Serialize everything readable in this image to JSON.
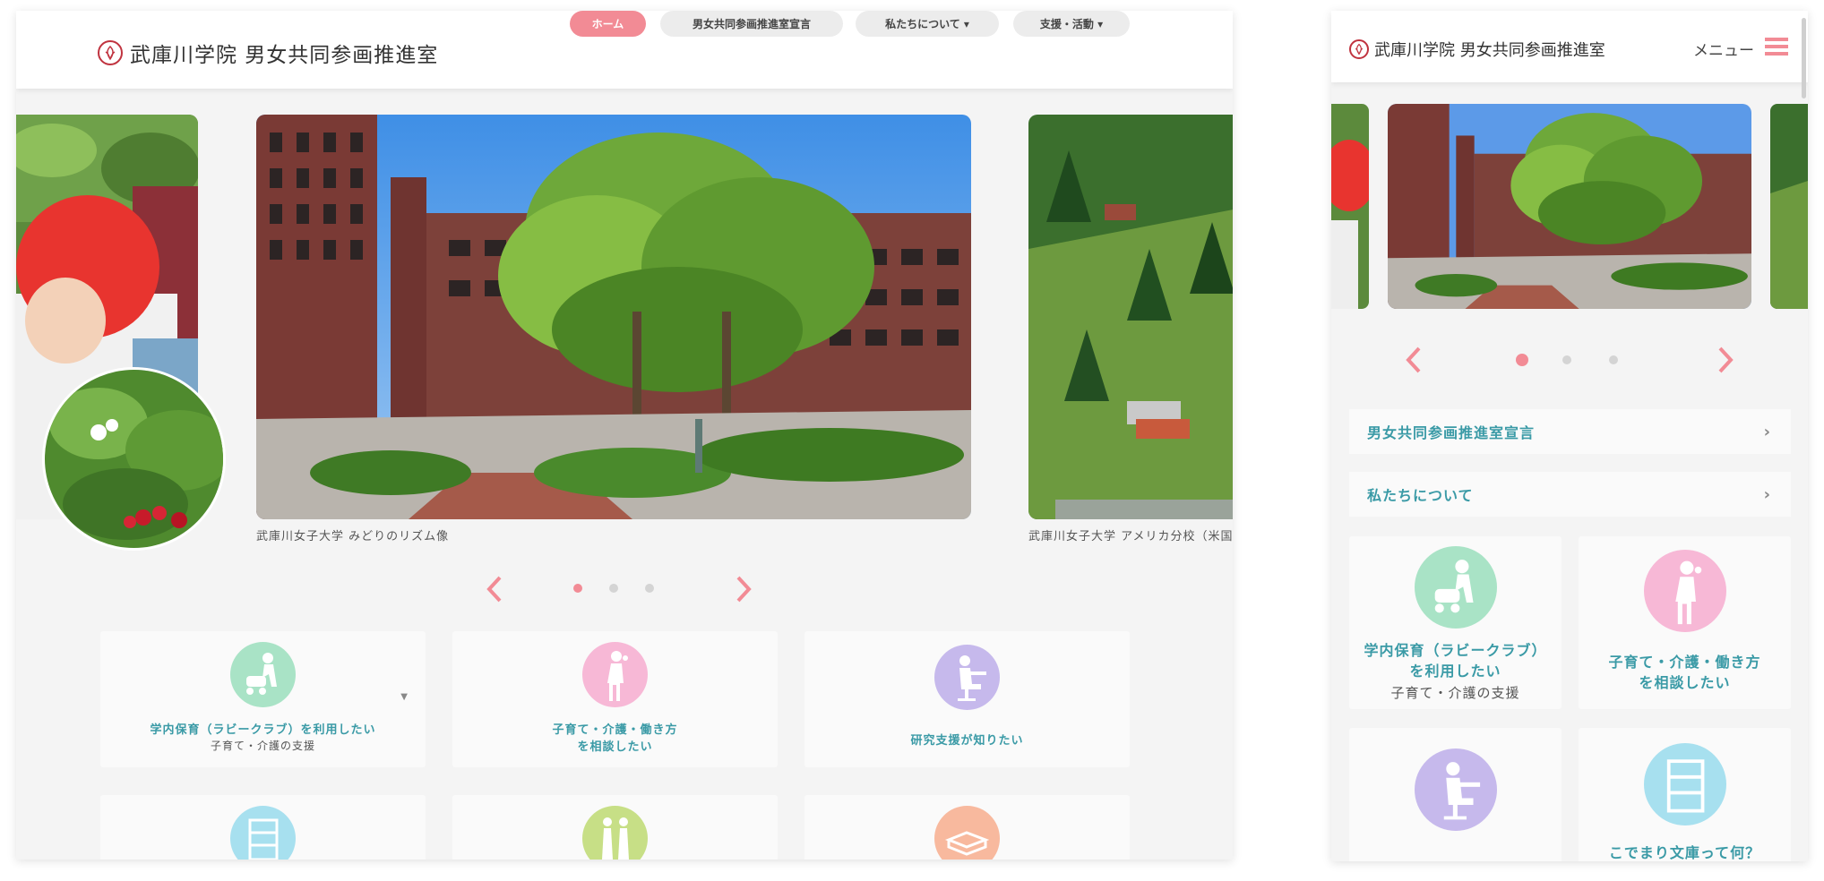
{
  "brand": {
    "name": "武庫川学院 男女共同参画推進室",
    "accent": "#f28b95",
    "teal": "#3a9aa6"
  },
  "nav": [
    {
      "label": "ホーム",
      "active": true
    },
    {
      "label": "男女共同参画推進室宣言",
      "active": false
    },
    {
      "label": "私たちについて ▾",
      "active": false
    },
    {
      "label": "支援・活動 ▾",
      "active": false
    }
  ],
  "slides": {
    "left_caption": "",
    "main_caption": "武庫川女子大学 みどりのリズム像",
    "right_caption": "武庫川女子大学 アメリカ分校（米国"
  },
  "cards": [
    {
      "title": "学内保育（ラビークラブ）を利用したい",
      "sub": "子育て・介護の支援",
      "icon": "stroller-person-icon",
      "color": "#a9e3c6"
    },
    {
      "title": "子育て・介護・働き方\nを相談したい",
      "sub": "",
      "icon": "woman-on-phone-icon",
      "color": "#f7b8d6"
    },
    {
      "title": "研究支援が知りたい",
      "sub": "",
      "icon": "person-at-desk-icon",
      "color": "#c6b9ec"
    },
    {
      "title": "こでまり文庫って何？",
      "sub": "",
      "icon": "bookshelf-icon",
      "color": "#a7e0ef"
    },
    {
      "title": "",
      "sub": "",
      "icon": "family-walking-icon",
      "color": "#c7df86"
    },
    {
      "title": "",
      "sub": "",
      "icon": "book-icon",
      "color": "#f8b99e"
    }
  ],
  "mobile": {
    "brand": "武庫川学院 男女共同参画推進室",
    "menu_label": "メニュー",
    "list": [
      {
        "label": "男女共同参画推進室宣言"
      },
      {
        "label": "私たちについて"
      }
    ],
    "cards": [
      {
        "title": "学内保育（ラビークラブ）\nを利用したい",
        "sub": "子育て・介護の支援"
      },
      {
        "title": "子育て・介護・働き方\nを相談したい",
        "sub": ""
      },
      {
        "title": "",
        "sub": ""
      },
      {
        "title": "こでまり文庫って何？",
        "sub": ""
      }
    ]
  },
  "carousel": {
    "current": 1,
    "total": 3
  }
}
